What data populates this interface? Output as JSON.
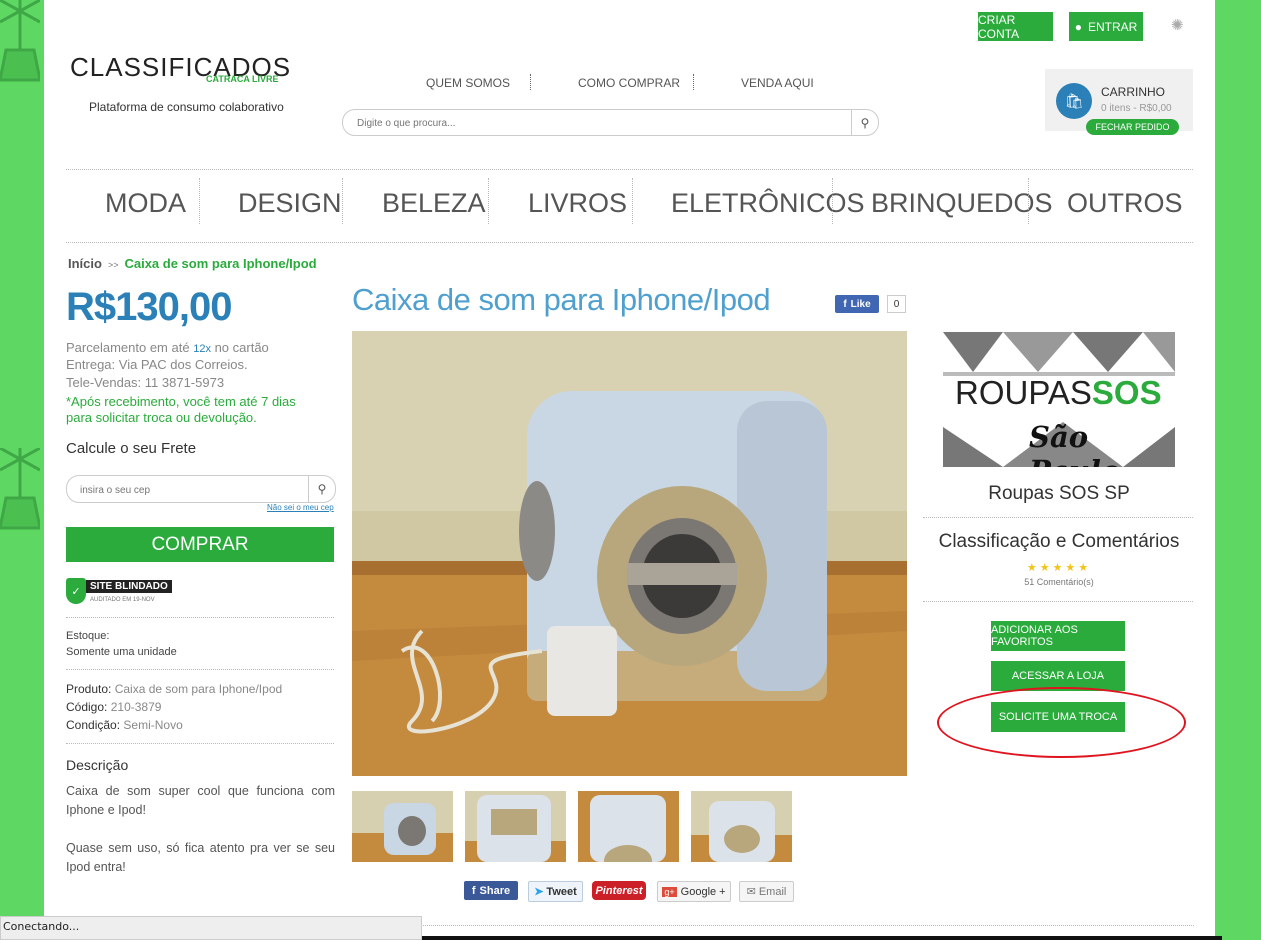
{
  "header": {
    "logo_text": "CLASSIFICADOS",
    "logo_subtext": "CATRACA LIVRE",
    "tagline": "Plataforma de consumo colaborativo",
    "create_account": "CRIAR CONTA",
    "login": "ENTRAR",
    "top_links": [
      "QUEM SOMOS",
      "COMO COMPRAR",
      "VENDA AQUI"
    ],
    "search_placeholder": "Digite o que procura...",
    "cart": {
      "title": "CARRINHO",
      "items": "0 itens - R$0,00",
      "checkout": "FECHAR PEDIDO"
    }
  },
  "categories": [
    "MODA",
    "DESIGN",
    "BELEZA",
    "LIVROS",
    "ELETRÔNICOS",
    "BRINQUEDOS",
    "OUTROS"
  ],
  "breadcrumb": {
    "home": "Início",
    "separator": ">>",
    "current": "Caixa de som para Iphone/Ipod"
  },
  "product": {
    "title": "Caixa de som para Iphone/Ipod",
    "price": "R$130,00",
    "installments_prefix": "Parcelamento em até",
    "installments_count": "12x",
    "installments_suffix": "no cartão",
    "delivery": "Entrega: Via PAC dos Correios.",
    "phone": "Tele-Vendas: 11 3871-5973",
    "return_policy_line1": "*Após recebimento, você tem até 7 dias",
    "return_policy_line2": "para solicitar troca ou devolução.",
    "shipping_title": "Calcule o seu Frete",
    "cep_placeholder": "insira o seu cep",
    "cep_help": "Não sei o meu cep",
    "buy_button": "COMPRAR",
    "security_badge": "SITE BLINDADO",
    "security_badge_sub": "AUDITADO EM 19-NOV",
    "stock_label": "Estoque:",
    "stock_value": "Somente uma unidade",
    "product_label": "Produto:",
    "product_value": "Caixa de som para Iphone/Ipod",
    "code_label": "Código:",
    "code_value": "210-3879",
    "condition_label": "Condição:",
    "condition_value": "Semi-Novo",
    "description_title": "Descrição",
    "description_p1": "Caixa de som super cool que funciona com Iphone e Ipod!",
    "description_p2": "Quase sem uso, só fica atento pra ver se seu Ipod entra!",
    "like_label": "Like",
    "like_count": "0"
  },
  "share": {
    "facebook": "Share",
    "twitter": "Tweet",
    "pinterest": "Pinterest",
    "google": "Google +",
    "email": "Email"
  },
  "store": {
    "banner_line1": "ROUPAS",
    "banner_line1b": "SOS",
    "banner_line2": "São Paulo",
    "name": "Roupas SOS SP",
    "rating_title": "Classificação e Comentários",
    "stars": "★★★★★",
    "comments": "51 Comentário(s)",
    "btn_favorites": "ADICIONAR AOS FAVORITOS",
    "btn_store": "ACESSAR A LOJA",
    "btn_exchange": "SOLICITE UMA TROCA"
  },
  "status_bar": "Conectando...",
  "colors": {
    "green": "#2aab3c",
    "blue": "#2b80b8",
    "background": "#5fd863",
    "annotation": "#e0141e"
  }
}
